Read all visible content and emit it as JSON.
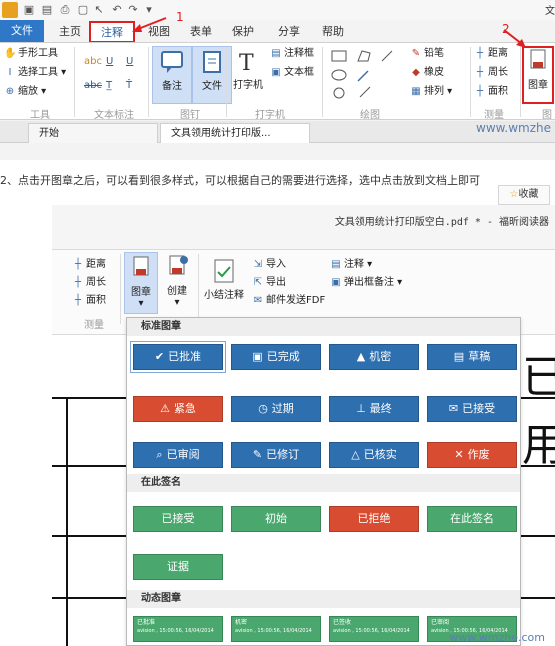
{
  "toolbar": {
    "window_title_fragment": "文"
  },
  "tabs": {
    "file": "文件",
    "home": "主页",
    "comment": "注释",
    "view": "视图",
    "form": "表单",
    "protect": "保护",
    "share": "分享",
    "help": "帮助"
  },
  "steps": {
    "one": "1",
    "two": "2"
  },
  "ribbon": {
    "tools": {
      "hand": "手形工具",
      "select": "选择工具",
      "zoom": "缩放",
      "group": "工具"
    },
    "text_markup": {
      "group": "文本标注",
      "b1": "abc",
      "b2": "U",
      "b3": "U",
      "b4": "abc"
    },
    "pin": {
      "note": "备注",
      "file": "文件",
      "group": "图钉"
    },
    "typewriter": {
      "typewriter": "打字机",
      "callout": "注释框",
      "textbox": "文本框",
      "group": "打字机"
    },
    "drawing": {
      "group": "绘图"
    },
    "tools2": {
      "pencil": "铅笔",
      "eraser": "橡皮",
      "arrange": "排列"
    },
    "measure": {
      "distance": "距离",
      "perimeter": "周长",
      "area": "面积",
      "group": "测量"
    },
    "stamp": {
      "label": "图章",
      "group": "图"
    }
  },
  "doc_tabs": {
    "start": "开始",
    "current": "文具领用统计打印版..."
  },
  "watermark": "www.wmzhe",
  "instruction": "2、点击开图章之后，可以看到很多样式，可以根据自己的需要进行选择，选中点击放到文档上即可",
  "favorite": "收藏",
  "shot2": {
    "title": "文具领用统计打印版空白.pdf * - 福昕阅读器",
    "measure": {
      "distance": "距离",
      "perimeter": "周长",
      "area": "面积",
      "group": "测量"
    },
    "stamp": "图章",
    "create": "创建",
    "summary": "小结注释",
    "import": "导入",
    "export": "导出",
    "email": "邮件发送FDF",
    "comment": "注释",
    "popup": "弹出框备注"
  },
  "stamp_panel": {
    "standard_title": "标准图章",
    "standard": [
      {
        "label": "已批准",
        "color": "#2e6fb0",
        "icon": "check-icon"
      },
      {
        "label": "已完成",
        "color": "#2e6fb0",
        "icon": "doc-check-icon"
      },
      {
        "label": "机密",
        "color": "#2e6fb0",
        "icon": "lock-icon"
      },
      {
        "label": "草稿",
        "color": "#2e6fb0",
        "icon": "draft-icon"
      },
      {
        "label": "紧急",
        "color": "#d84d31",
        "icon": "warning-icon"
      },
      {
        "label": "过期",
        "color": "#2e6fb0",
        "icon": "clock-icon"
      },
      {
        "label": "最终",
        "color": "#2e6fb0",
        "icon": "stamp-icon"
      },
      {
        "label": "已接受",
        "color": "#2e6fb0",
        "icon": "envelope-icon"
      },
      {
        "label": "已审阅",
        "color": "#2e6fb0",
        "icon": "magnifier-icon"
      },
      {
        "label": "已修订",
        "color": "#2e6fb0",
        "icon": "pen-icon"
      },
      {
        "label": "已核实",
        "color": "#2e6fb0",
        "icon": "triangle-icon"
      },
      {
        "label": "作废",
        "color": "#d84d31",
        "icon": "x-icon"
      }
    ],
    "sign_title": "在此签名",
    "sign": [
      {
        "label": "已接受",
        "color": "#4aa86e"
      },
      {
        "label": "初始",
        "color": "#4aa86e"
      },
      {
        "label": "已拒绝",
        "color": "#d84d31"
      },
      {
        "label": "在此签名",
        "color": "#4aa86e"
      },
      {
        "label": "证据",
        "color": "#4aa86e"
      }
    ],
    "dynamic_title": "动态图章",
    "dynamic": [
      {
        "label": "已批准",
        "meta": "avision , 15:00:56, 16/04/2014"
      },
      {
        "label": "机密",
        "meta": "avision , 15:00:56, 16/04/2014"
      },
      {
        "label": "已签收",
        "meta": "avision , 15:00:56, 16/04/2014"
      },
      {
        "label": "已审阅",
        "meta": "avision , 15:00:56, 16/04/2014"
      }
    ]
  },
  "doc_chars": {
    "c1": "已",
    "c2": "用"
  },
  "watermark2": "www.wmzhe.com"
}
